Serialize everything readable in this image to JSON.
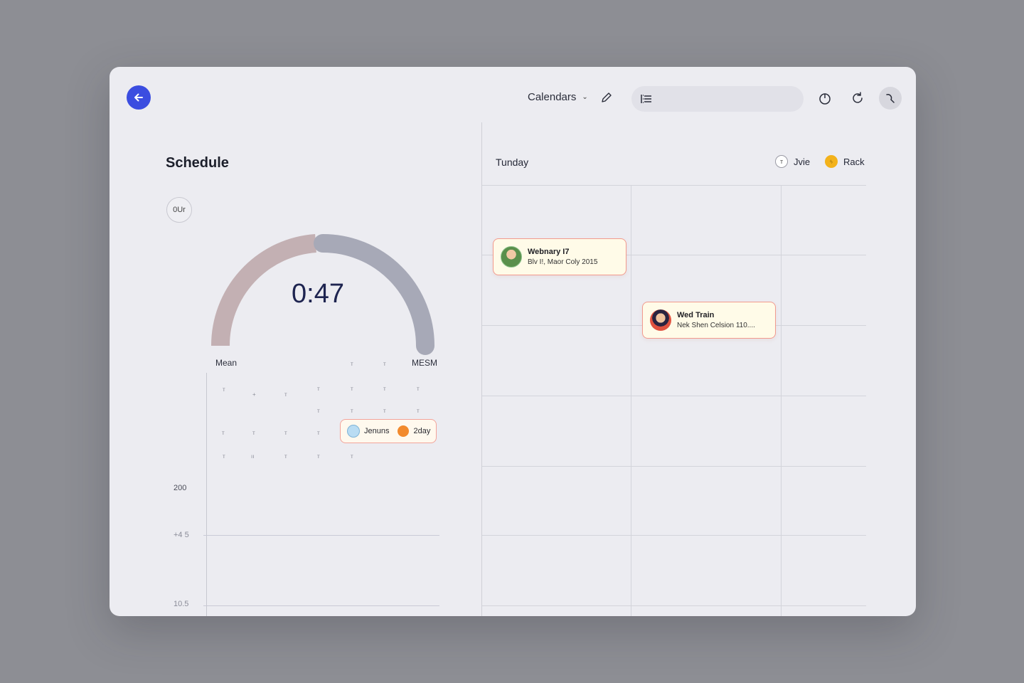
{
  "header": {
    "calendar_select": "Calendars",
    "search": {
      "value": "",
      "placeholder": ""
    }
  },
  "schedule": {
    "title": "Schedule",
    "out_chip": "0Ur",
    "gauge": {
      "value_text": "0:47",
      "left_label": "Mean",
      "right_label": "MESM",
      "fill_fraction": 0.47
    },
    "ticks_row0": [
      "т",
      "т"
    ],
    "grid_ticks": [
      [
        "т",
        "+",
        "т",
        "т",
        "т",
        "т",
        "т"
      ],
      [
        "т",
        "т",
        "т",
        "т"
      ],
      [
        "т",
        "т",
        "т",
        "т"
      ],
      [
        "т",
        "ıı",
        "т",
        "т",
        "т"
      ]
    ],
    "y_labels": [
      "200",
      "+4 5",
      "10.5"
    ],
    "pill": {
      "name": "Jenuns",
      "tag": "2day"
    }
  },
  "day_view": {
    "title": "Tunday",
    "people": [
      {
        "initial": "т",
        "name": "Jvie",
        "color": "#ffffff"
      },
      {
        "initial": "ᛃ",
        "name": "Rack",
        "color": "#f3b21b"
      }
    ],
    "events": [
      {
        "title": "Webnary I7",
        "subtitle": "Blv I!, Maor Coly 2015",
        "avatar_color": "#8bc28a"
      },
      {
        "title": "Wed Train",
        "subtitle": "Nek Shen Celsion 110....",
        "avatar_color": "#e0523f"
      }
    ]
  },
  "colors": {
    "accent": "#3b4de0",
    "gauge_left": "#c3b0b3",
    "gauge_right": "#a7a9b7",
    "event_border": "#f29a8e"
  }
}
